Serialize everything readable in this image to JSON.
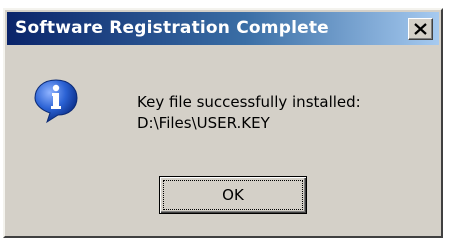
{
  "window": {
    "title": "Software Registration Complete",
    "close_icon": "close-icon"
  },
  "dialog": {
    "icon": "info-icon",
    "message_line1": "Key file successfully installed:",
    "message_line2": "D:\\Files\\USER.KEY"
  },
  "buttons": {
    "ok_label": "OK"
  },
  "colors": {
    "titlebar_start": "#0a246a",
    "titlebar_end": "#a6caf0",
    "face": "#d4d0c8",
    "icon_blue": "#1f57c8"
  }
}
